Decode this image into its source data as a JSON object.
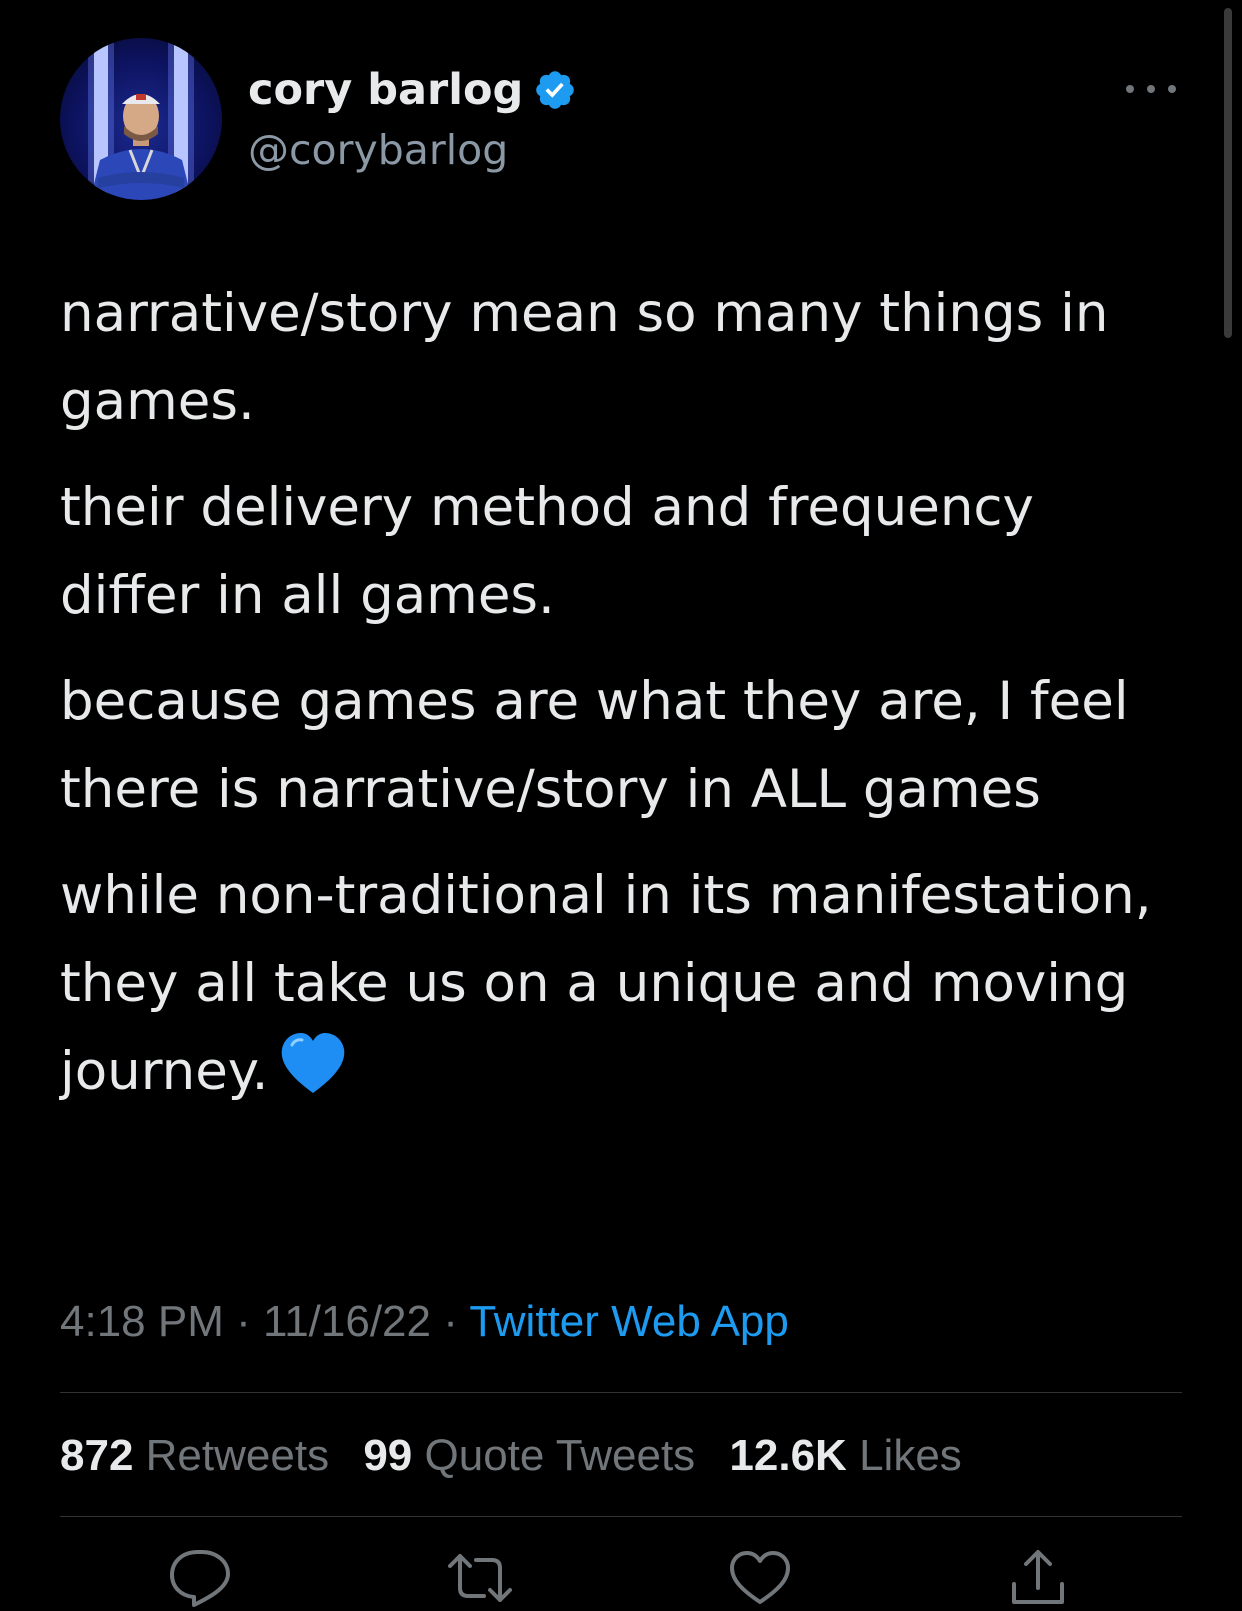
{
  "author": {
    "display_name": "cory barlog",
    "handle": "@corybarlog",
    "verified": true
  },
  "tweet": {
    "paragraphs": [
      "narrative/story mean so many things in games.",
      "their delivery method and frequency differ in all games.",
      "because games are what they are, I feel there is narrative/story in ALL games",
      "while non-traditional in its manifestation, they all take us on a unique and moving journey."
    ],
    "emoji": "blue-heart"
  },
  "meta": {
    "time": "4:18 PM",
    "sep1": " · ",
    "date": "11/16/22",
    "sep2": " · ",
    "source": "Twitter Web App"
  },
  "stats": {
    "retweets_count": "872",
    "retweets_label": "Retweets",
    "quotes_count": "99",
    "quotes_label": "Quote Tweets",
    "likes_count": "12.6K",
    "likes_label": "Likes"
  },
  "actions": [
    "reply-icon",
    "retweet-icon",
    "like-icon",
    "share-icon"
  ],
  "colors": {
    "background": "#000000",
    "text": "#e7e9ea",
    "secondary": "#71767b",
    "accent": "#1d9bf0",
    "divider": "#2f3336"
  }
}
